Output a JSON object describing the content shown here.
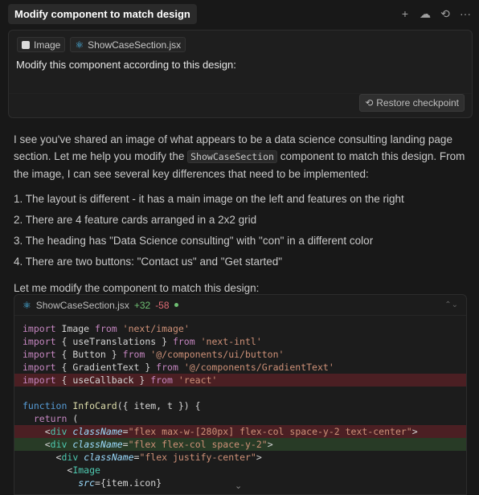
{
  "header": {
    "title": "Modify component to match design",
    "actions": [
      {
        "name": "new-chat-icon",
        "glyph": "+"
      },
      {
        "name": "cloud-icon",
        "glyph": "☁"
      },
      {
        "name": "history-icon",
        "glyph": "⟲"
      },
      {
        "name": "more-icon",
        "glyph": "···"
      }
    ]
  },
  "prompt": {
    "attachments": [
      {
        "label": "Image",
        "icon": "image-icon"
      },
      {
        "label": "ShowCaseSection.jsx",
        "icon": "react-icon"
      }
    ],
    "text": "Modify this component according to this design:",
    "restore_label": "Restore checkpoint"
  },
  "response": {
    "intro_1": "I see you've shared an image of what appears to be a data science consulting landing page section. Let me help you modify the ",
    "intro_code": "ShowCaseSection",
    "intro_2": " component to match this design. From the image, I can see several key differences that need to be implemented:",
    "list": [
      "1. The layout is different - it has a main image on the left and features on the right",
      "2. There are 4 feature cards arranged in a 2x2 grid",
      "3. The heading has \"Data Science consulting\" with \"con\" in a different color",
      "4. There are two buttons: \"Contact us\" and \"Get started\""
    ],
    "outro": "Let me modify the component to match this design:"
  },
  "code": {
    "filename": "ShowCaseSection.jsx",
    "additions": "+32",
    "deletions": "-58",
    "lines": [
      {
        "state": "normal",
        "indent": 0,
        "tokens": [
          [
            "kw",
            "import"
          ],
          [
            "plain",
            " Image "
          ],
          [
            "kw",
            "from"
          ],
          [
            "plain",
            " "
          ],
          [
            "str",
            "'next/image'"
          ]
        ]
      },
      {
        "state": "normal",
        "indent": 0,
        "tokens": [
          [
            "kw",
            "import"
          ],
          [
            "plain",
            " { useTranslations } "
          ],
          [
            "kw",
            "from"
          ],
          [
            "plain",
            " "
          ],
          [
            "str",
            "'next-intl'"
          ]
        ]
      },
      {
        "state": "normal",
        "indent": 0,
        "tokens": [
          [
            "kw",
            "import"
          ],
          [
            "plain",
            " { Button } "
          ],
          [
            "kw",
            "from"
          ],
          [
            "plain",
            " "
          ],
          [
            "str",
            "'@/components/ui/button'"
          ]
        ]
      },
      {
        "state": "normal",
        "indent": 0,
        "tokens": [
          [
            "kw",
            "import"
          ],
          [
            "plain",
            " { GradientText } "
          ],
          [
            "kw",
            "from"
          ],
          [
            "plain",
            " "
          ],
          [
            "str",
            "'@/components/GradientText'"
          ]
        ]
      },
      {
        "state": "del",
        "indent": 0,
        "tokens": [
          [
            "kw",
            "import"
          ],
          [
            "plain",
            " { useCallback } "
          ],
          [
            "kw",
            "from"
          ],
          [
            "plain",
            " "
          ],
          [
            "str",
            "'react'"
          ]
        ]
      },
      {
        "state": "normal",
        "indent": 0,
        "tokens": [
          [
            "plain",
            ""
          ]
        ]
      },
      {
        "state": "normal",
        "indent": 0,
        "tokens": [
          [
            "kw2",
            "function"
          ],
          [
            "plain",
            " "
          ],
          [
            "fn",
            "InfoCard"
          ],
          [
            "plain",
            "({ item, t }) {"
          ]
        ]
      },
      {
        "state": "normal",
        "indent": 1,
        "tokens": [
          [
            "kw",
            "return"
          ],
          [
            "plain",
            " ("
          ]
        ]
      },
      {
        "state": "del",
        "indent": 2,
        "tokens": [
          [
            "plain",
            "<"
          ],
          [
            "tag",
            "div"
          ],
          [
            "plain",
            " "
          ],
          [
            "attr",
            "className"
          ],
          [
            "plain",
            "="
          ],
          [
            "str",
            "\"flex max-w-[280px] flex-col space-y-2 text-center\""
          ],
          [
            "plain",
            ">"
          ]
        ]
      },
      {
        "state": "add",
        "indent": 2,
        "tokens": [
          [
            "plain",
            "<"
          ],
          [
            "tag",
            "div"
          ],
          [
            "plain",
            " "
          ],
          [
            "attr",
            "className"
          ],
          [
            "plain",
            "="
          ],
          [
            "str",
            "\"flex flex-col space-y-2\""
          ],
          [
            "plain",
            ">"
          ]
        ]
      },
      {
        "state": "normal",
        "indent": 3,
        "tokens": [
          [
            "plain",
            "<"
          ],
          [
            "tag",
            "div"
          ],
          [
            "plain",
            " "
          ],
          [
            "attr",
            "className"
          ],
          [
            "plain",
            "="
          ],
          [
            "str",
            "\"flex justify-center\""
          ],
          [
            "plain",
            ">"
          ]
        ]
      },
      {
        "state": "normal",
        "indent": 4,
        "tokens": [
          [
            "plain",
            "<"
          ],
          [
            "tag",
            "Image"
          ]
        ]
      },
      {
        "state": "normal",
        "indent": 5,
        "tokens": [
          [
            "attr",
            "src"
          ],
          [
            "plain",
            "={item.icon}"
          ]
        ]
      }
    ]
  }
}
